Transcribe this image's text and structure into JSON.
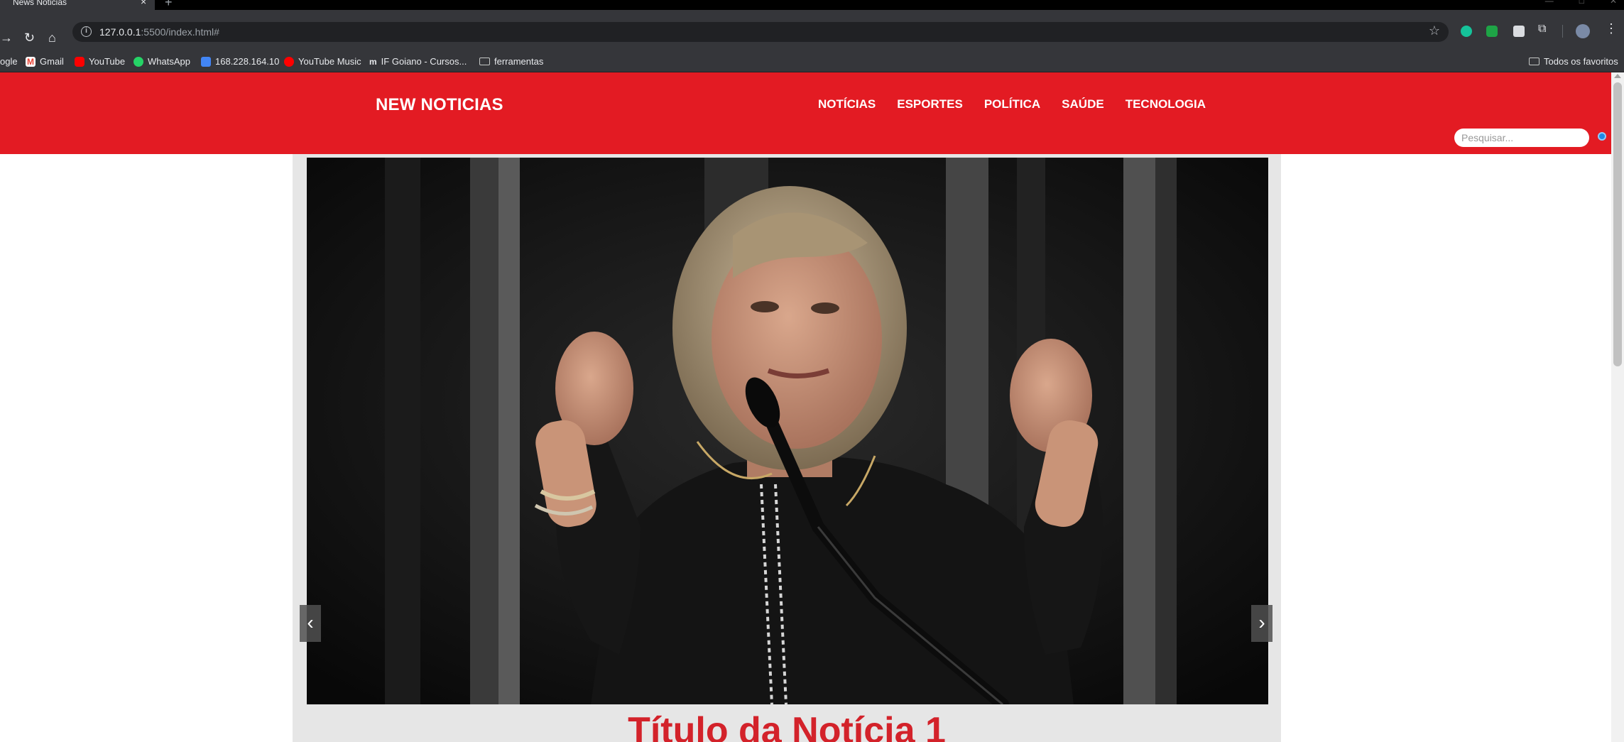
{
  "browser": {
    "tab_title": "News Noticias",
    "url_host": "127.0.0.1",
    "url_rest": ":5500/index.html#",
    "bookmarks": [
      {
        "label": "ogle",
        "icon": "google-icon"
      },
      {
        "label": "Gmail",
        "icon": "gmail-icon",
        "color": "#ea4335"
      },
      {
        "label": "YouTube",
        "icon": "youtube-icon",
        "color": "#ff0000"
      },
      {
        "label": "WhatsApp",
        "icon": "whatsapp-icon",
        "color": "#25d366"
      },
      {
        "label": "168.228.164.10",
        "icon": "server-icon",
        "color": "#4285f4"
      },
      {
        "label": "YouTube Music",
        "icon": "youtube-music-icon",
        "color": "#ff0000"
      },
      {
        "label": "IF Goiano - Cursos...",
        "icon": "moodle-icon"
      },
      {
        "label": "ferramentas",
        "icon": "folder-icon"
      }
    ],
    "all_bookmarks": "Todos os favoritos"
  },
  "site": {
    "logo": "NEW NOTICIAS",
    "nav": [
      "NOTÍCIAS",
      "ESPORTES",
      "POLÍTICA",
      "SAÚDE",
      "TECNOLOGIA"
    ],
    "search_placeholder": "Pesquisar...",
    "accent": "#e31b23"
  },
  "carousel": {
    "prev": "‹",
    "next": "›",
    "slide_title": "Título da Notícia 1"
  }
}
